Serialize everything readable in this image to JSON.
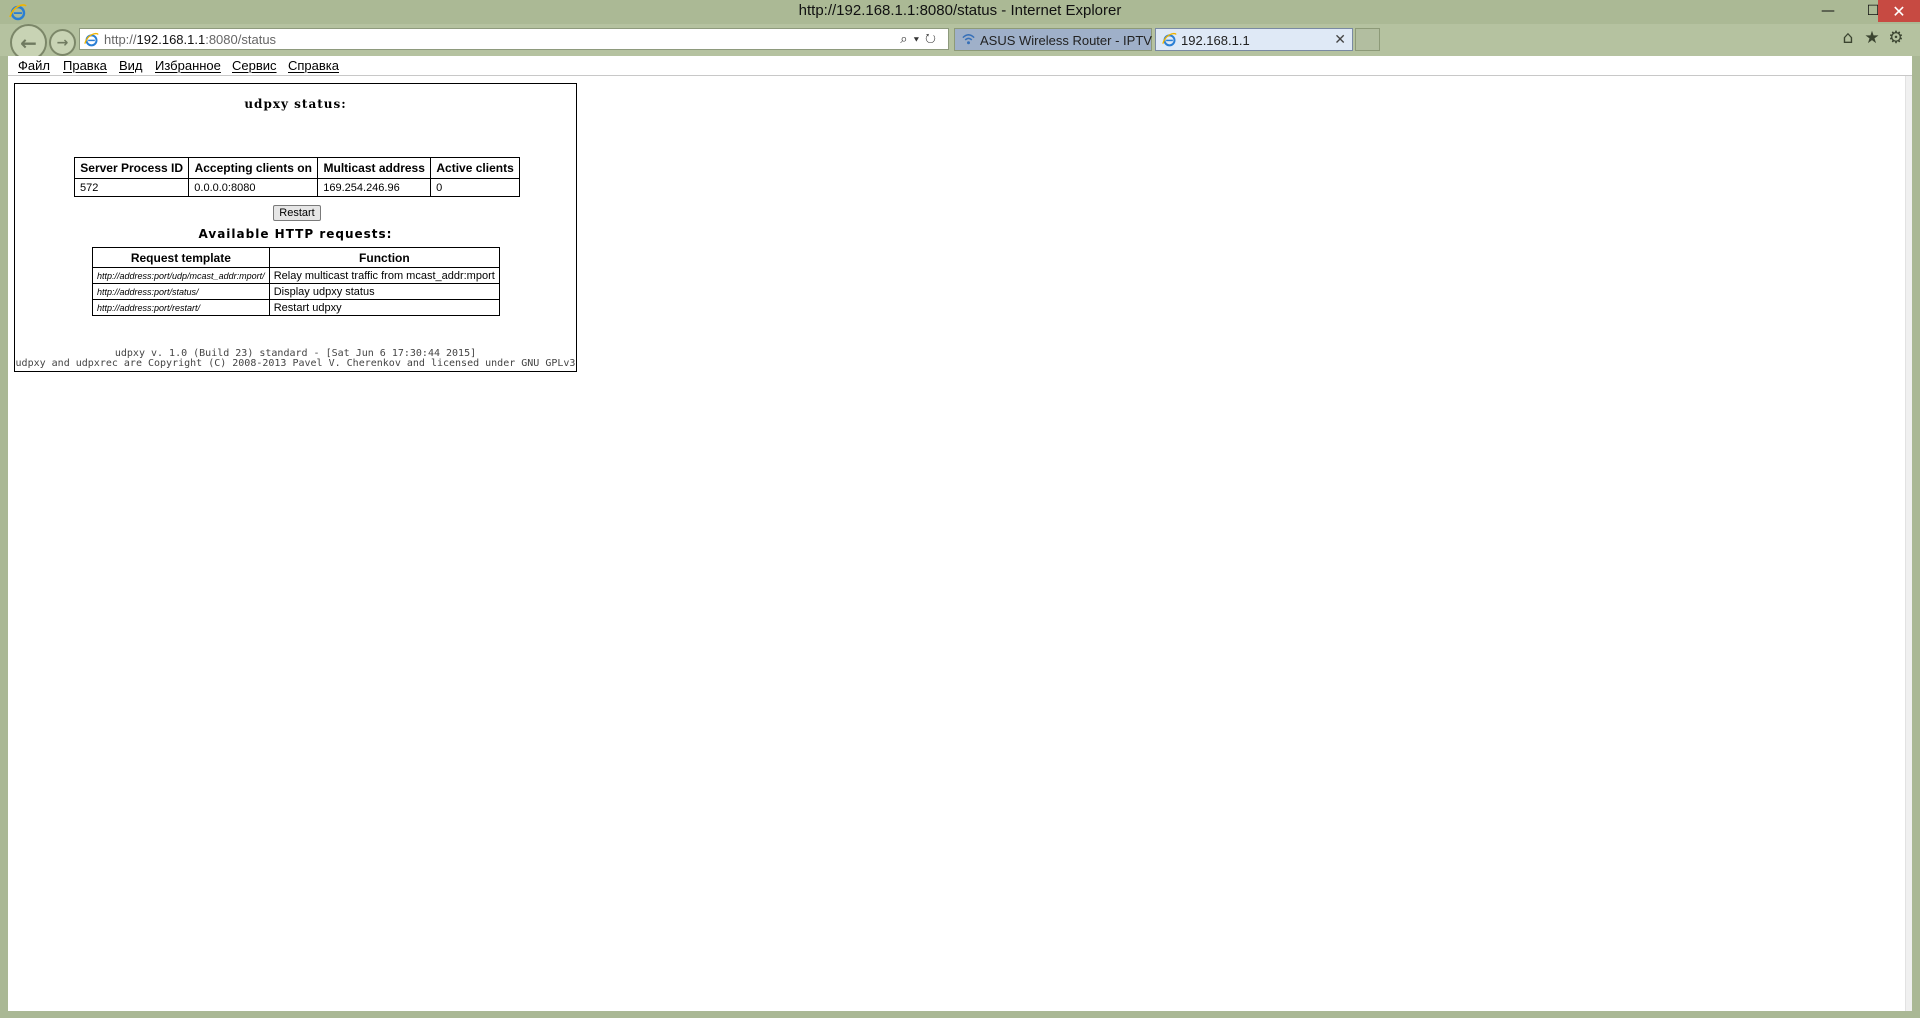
{
  "window": {
    "title": "http://192.168.1.1:8080/status - Internet Explorer",
    "minimize": "—",
    "maximize": "☐",
    "close": "✕"
  },
  "nav": {
    "address_prefix": "http://",
    "address_host": "192.168.1.1",
    "address_rest": ":8080/status",
    "address_icons": "⌕▾↻"
  },
  "tabs": [
    {
      "label": "ASUS Wireless Router - IPTV"
    },
    {
      "label": "192.168.1.1",
      "close": "✕"
    }
  ],
  "toolbar": {
    "home": "⌂",
    "favorites": "★",
    "settings": "⚙"
  },
  "menu": [
    "Файл",
    "Правка",
    "Вид",
    "Избранное",
    "Сервис",
    "Справка"
  ],
  "page": {
    "title": "udpxy status:",
    "status_headers": [
      "Server Process ID",
      "Accepting clients on",
      "Multicast address",
      "Active clients"
    ],
    "status_row": [
      "572",
      "0.0.0.0:8080",
      "169.254.246.96",
      "0"
    ],
    "restart_label": "Restart",
    "requests_title": "Available HTTP requests:",
    "requests_headers": [
      "Request template",
      "Function"
    ],
    "requests_rows": [
      [
        "http://address:port/udp/mcast_addr:mport/",
        "Relay multicast traffic from mcast_addr:mport"
      ],
      [
        "http://address:port/status/",
        "Display udpxy status"
      ],
      [
        "http://address:port/restart/",
        "Restart udpxy"
      ]
    ],
    "footer_line1": "udpxy v. 1.0 (Build 23) standard - [Sat Jun 6 17:30:44 2015]",
    "footer_line2": "udpxy and udpxrec are Copyright (C) 2008-2013 Pavel V. Cherenkov and licensed under GNU GPLv3"
  }
}
